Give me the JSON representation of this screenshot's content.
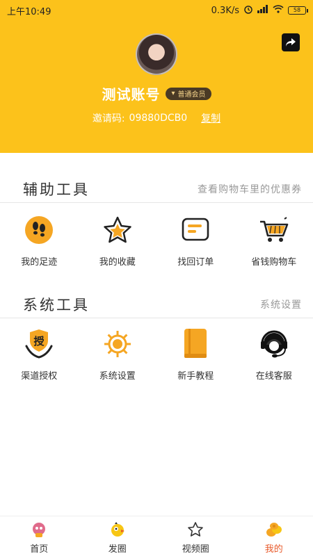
{
  "status_bar": {
    "time": "上午10:49",
    "network_speed": "0.3K/s",
    "battery": "58"
  },
  "profile": {
    "username": "测试账号",
    "member_level": "普通会员",
    "invite_label": "邀请码:",
    "invite_code": "09880DCB0",
    "copy_label": "复制"
  },
  "aux_tools": {
    "title": "辅助工具",
    "link": "查看购物车里的优惠券",
    "items": [
      {
        "label": "我的足迹",
        "icon": "footprint-icon"
      },
      {
        "label": "我的收藏",
        "icon": "star-icon"
      },
      {
        "label": "找回订单",
        "icon": "order-icon"
      },
      {
        "label": "省钱购物车",
        "icon": "cart-icon"
      }
    ]
  },
  "sys_tools": {
    "title": "系统工具",
    "link": "系统设置",
    "items": [
      {
        "label": "渠道授权",
        "icon": "authorize-icon",
        "icon_text": "授"
      },
      {
        "label": "系统设置",
        "icon": "gear-icon"
      },
      {
        "label": "新手教程",
        "icon": "book-icon"
      },
      {
        "label": "在线客服",
        "icon": "headset-icon"
      }
    ]
  },
  "tabbar": {
    "items": [
      {
        "label": "首页",
        "icon": "home-icon"
      },
      {
        "label": "发圈",
        "icon": "bird-icon"
      },
      {
        "label": "视频圈",
        "icon": "star-outline-icon"
      },
      {
        "label": "我的",
        "icon": "coins-icon",
        "active": true
      }
    ]
  },
  "colors": {
    "header_bg": "#fcc21b",
    "accent_orange": "#f5a623",
    "active_tab": "#e85a2b"
  }
}
